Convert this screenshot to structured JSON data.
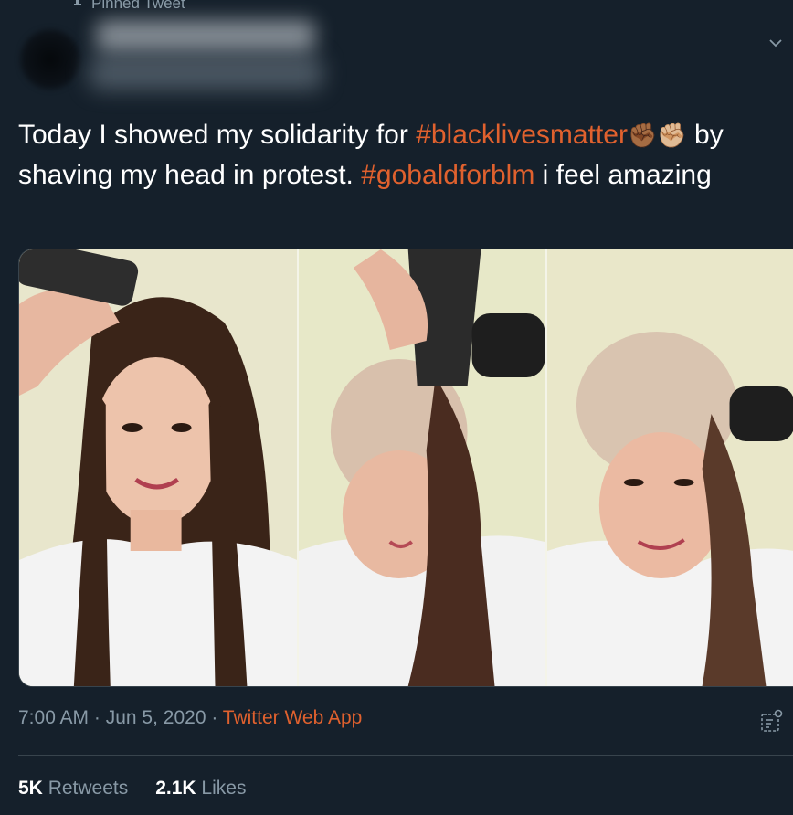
{
  "header": {
    "pinned_label": "Pinned Tweet"
  },
  "tweet": {
    "text_part1": "Today I showed my solidarity for ",
    "hashtag1": "#blacklivesmatter",
    "emoji": "✊🏾✊🏼",
    "text_part2": " by shaving my head in protest. ",
    "hashtag2": "#gobaldforblm",
    "text_part3": " i feel amazing"
  },
  "meta": {
    "time": "7:00 AM",
    "separator1": " · ",
    "date": "Jun 5, 2020",
    "separator2": " · ",
    "source": "Twitter Web App"
  },
  "stats": {
    "retweets_count": "5K",
    "retweets_label": " Retweets",
    "likes_count": "2.1K",
    "likes_label": " Likes"
  },
  "icons": [
    "pin-icon",
    "caret-down-icon",
    "analytics-icon"
  ],
  "colors": {
    "background": "#15202b",
    "accent": "#e0612e",
    "secondary_text": "#8899a6",
    "border": "#38444d"
  }
}
